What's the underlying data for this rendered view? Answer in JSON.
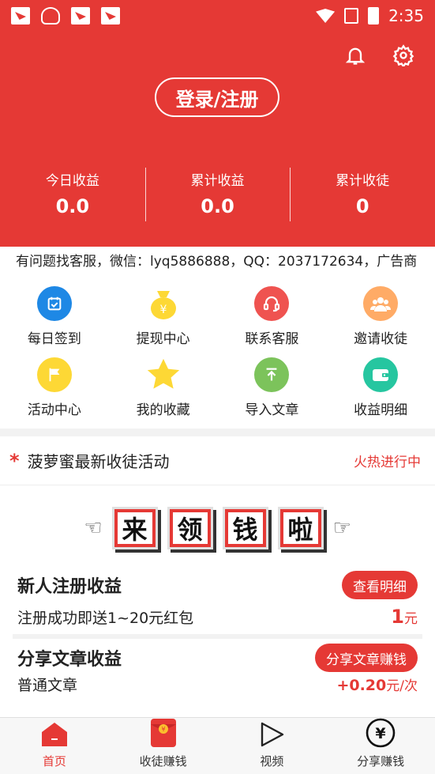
{
  "status_bar": {
    "time": "2:35",
    "icons": [
      "app-notification-icon",
      "ghost-app-icon",
      "app-notification-icon",
      "app-notification-icon",
      "wifi-icon",
      "no-signal-icon",
      "battery-charging-icon"
    ]
  },
  "header": {
    "bell_icon": "bell-icon",
    "settings_icon": "gear-icon",
    "login_label": "登录/注册",
    "stats": [
      {
        "label": "今日收益",
        "value": "0.0"
      },
      {
        "label": "累计收益",
        "value": "0.0"
      },
      {
        "label": "累计收徒",
        "value": "0"
      }
    ]
  },
  "notice": {
    "text": "有问题找客服，微信：lyq5886888，QQ：2037172634，广告商"
  },
  "menu": {
    "items": [
      {
        "label": "每日签到",
        "icon": "calendar-icon",
        "color": "#1e88e5"
      },
      {
        "label": "提现中心",
        "icon": "money-bag-icon",
        "color": "#fdd835"
      },
      {
        "label": "联系客服",
        "icon": "headset-icon",
        "color": "#ef5350"
      },
      {
        "label": "邀请收徒",
        "icon": "people-icon",
        "color": "#ffab66"
      },
      {
        "label": "活动中心",
        "icon": "flag-icon",
        "color": "#fdd835"
      },
      {
        "label": "我的收藏",
        "icon": "star-icon",
        "color": "#fdd835"
      },
      {
        "label": "导入文章",
        "icon": "upload-icon",
        "color": "#7cc35b"
      },
      {
        "label": "收益明细",
        "icon": "wallet-icon",
        "color": "#26c6a0"
      }
    ]
  },
  "activity": {
    "title": "菠萝蜜最新收徒活动",
    "status": "火热进行中",
    "banner_chars": [
      "来",
      "领",
      "钱",
      "啦"
    ],
    "cards": [
      {
        "title": "新人注册收益",
        "button": "查看明细",
        "desc": "注册成功即送1~20元红包",
        "amount": "1",
        "unit": "元"
      },
      {
        "title": "分享文章收益",
        "button": "分享文章赚钱",
        "desc": "普通文章",
        "amount": "+0.20",
        "unit": "元/次"
      }
    ]
  },
  "tabbar": {
    "tabs": [
      {
        "label": "首页",
        "icon": "home-icon",
        "active": true
      },
      {
        "label": "收徒赚钱",
        "icon": "red-envelope-icon",
        "active": false
      },
      {
        "label": "视频",
        "icon": "play-icon",
        "active": false
      },
      {
        "label": "分享赚钱",
        "icon": "yuan-icon",
        "active": false
      }
    ]
  },
  "colors": {
    "brand": "#e53935",
    "background": "#f2f2f2"
  }
}
